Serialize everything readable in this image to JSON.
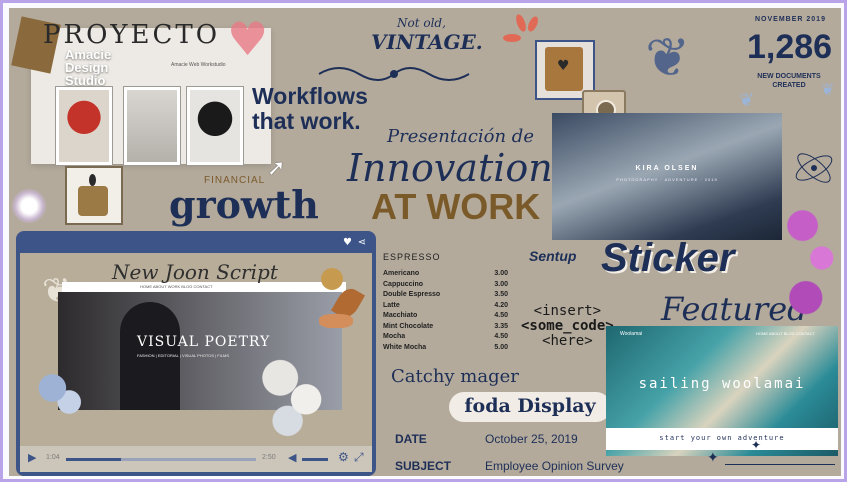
{
  "collage": {
    "proyecto": "PROYECTO",
    "studio_line1": "Amacie",
    "studio_line2": "Design",
    "studio_line3": "Studio",
    "tagline": "Amacie Web Workstudio"
  },
  "workflows": {
    "line1": "Workflows",
    "line2": "that work."
  },
  "financial": {
    "label": "FINANCIAL",
    "word": "growth"
  },
  "vintage": {
    "line1": "Not old,",
    "line2": "VINTAGE."
  },
  "presentation": {
    "script": "Presentación de",
    "innovation": "Innovation",
    "at_work": "AT WORK"
  },
  "stats": {
    "date": "NOVEMBER 2019",
    "number": "1,286",
    "caption_line1": "NEW DOCUMENTS",
    "caption_line2": "CREATED"
  },
  "portfolio": {
    "name": "KIRA OLSEN",
    "sub": "PHOTOGRAPHY · ADVENTURE · 2019"
  },
  "video": {
    "script_title": "New Joon Script",
    "headline": "VISUAL POETRY",
    "nav": "HOME   ABOUT   WORK   BLOG   CONTACT",
    "subline": "FASHION  |  EDITORIAL  |  VISUAL PHOTOS  |  FILMS",
    "time_left": "1:04",
    "time_right": "2:50"
  },
  "espresso": {
    "title": "ESPRESSO",
    "items": [
      {
        "name": "Americano",
        "price": "3.00"
      },
      {
        "name": "Cappuccino",
        "price": "3.00"
      },
      {
        "name": "Double Espresso",
        "price": "3.50"
      },
      {
        "name": "Latte",
        "price": "4.20"
      },
      {
        "name": "Macchiato",
        "price": "4.50"
      },
      {
        "name": "Mint Chocolate",
        "price": "3.35"
      },
      {
        "name": "Mocha",
        "price": "4.50"
      },
      {
        "name": "White Mocha",
        "price": "5.00"
      }
    ]
  },
  "sentup": "Sentup",
  "sticker": "Sticker",
  "featured": "Featured",
  "code": {
    "line1": "<insert>",
    "line2": "<some_code>",
    "line3": "<here>"
  },
  "catchy": "Catchy mager",
  "foda": "foda Display",
  "memo": {
    "date_label": "DATE",
    "date_value": "October 25, 2019",
    "subject_label": "SUBJECT",
    "subject_value": "Employee Opinion Survey"
  },
  "lagoon": {
    "brand": "Woolamai",
    "title": "sailing  woolamai",
    "cta": "start your own adventure",
    "nav": "HOME   ABOUT   BLOG   CONTACT"
  },
  "colors": {
    "board": "#b3aa9c",
    "navy": "#1e2f57",
    "brown": "#7b5a2a",
    "frame": "#3c5488",
    "border": "#b9a4ea"
  }
}
